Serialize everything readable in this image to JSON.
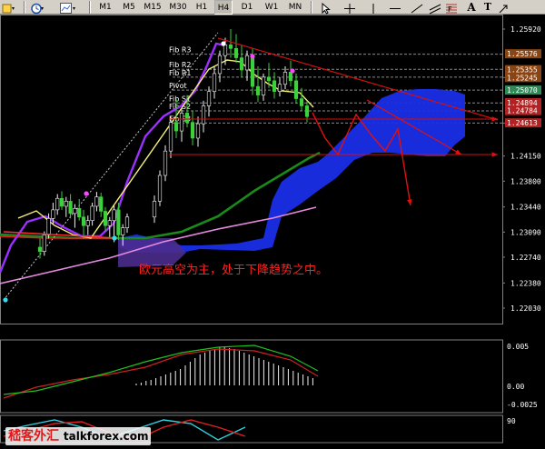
{
  "toolbar": {
    "timeframes": [
      "M1",
      "M5",
      "M15",
      "M30",
      "H1",
      "H4",
      "D1",
      "W1",
      "MN"
    ],
    "active_timeframe": "H4",
    "icons": [
      "dropdown-icon",
      "clock-icon",
      "chart-type-icon",
      "cursor-icon",
      "crosshair-icon",
      "vertical-line-icon",
      "horizontal-line-icon",
      "trendline-icon",
      "channel-icon",
      "fibonacci-icon",
      "text-icon",
      "label-icon",
      "arrow-tool-icon"
    ],
    "text_tool_label": "A",
    "label_tool_label": "T"
  },
  "annotation": "欧元高空为主，处于下降趋势之中。",
  "watermark": {
    "text": "嵇客外汇",
    "site": "talkforex.com"
  },
  "chart_data": {
    "type": "candlestick",
    "symbol_period": "H4",
    "price_axis_labels": [
      "1.25920",
      "1.25245",
      "1.24610",
      "1.24150",
      "1.23800",
      "1.23440",
      "1.23090",
      "1.22740",
      "1.22380",
      "1.22030"
    ],
    "highlighted_prices": [
      {
        "value": "1.25576",
        "color": "#8b4513"
      },
      {
        "value": "1.25355",
        "color": "#8b4513"
      },
      {
        "value": "1.25245",
        "color": "#8b4513"
      },
      {
        "value": "1.25070",
        "color": "#2e8b57"
      },
      {
        "value": "1.24894",
        "color": "#b22222"
      },
      {
        "value": "1.24784",
        "color": "#b22222"
      },
      {
        "value": "1.24613",
        "color": "#b22222"
      }
    ],
    "fib_levels": [
      {
        "label": "Fib R3",
        "price": 1.2557
      },
      {
        "label": "Fib R2",
        "price": 1.2536
      },
      {
        "label": "Fib R1",
        "price": 1.2525
      },
      {
        "label": "Pivot",
        "price": 1.2507
      },
      {
        "label": "Fib S1",
        "price": 1.2489
      },
      {
        "label": "Fib S2",
        "price": 1.2478
      },
      {
        "label": "Fib S3",
        "price": 1.2461
      }
    ],
    "ylim": [
      1.2195,
      1.2602
    ],
    "n_bars": 80,
    "candles": [
      [
        1.2288,
        1.23,
        1.2272,
        1.2282
      ],
      [
        1.2282,
        1.231,
        1.2276,
        1.2305
      ],
      [
        1.2305,
        1.2335,
        1.23,
        1.2328
      ],
      [
        1.2328,
        1.235,
        1.232,
        1.234
      ],
      [
        1.234,
        1.2362,
        1.2333,
        1.2356
      ],
      [
        1.2356,
        1.2366,
        1.234,
        1.2345
      ],
      [
        1.2345,
        1.2358,
        1.233,
        1.2352
      ],
      [
        1.2352,
        1.2362,
        1.2328,
        1.2335
      ],
      [
        1.2335,
        1.2348,
        1.2315,
        1.2342
      ],
      [
        1.2342,
        1.2355,
        1.2325,
        1.233
      ],
      [
        1.233,
        1.234,
        1.23,
        1.2318
      ],
      [
        1.2318,
        1.2332,
        1.2305,
        1.2325
      ],
      [
        1.2325,
        1.235,
        1.2318,
        1.2345
      ],
      [
        1.2345,
        1.2365,
        1.2338,
        1.2358
      ],
      [
        1.2358,
        1.2364,
        1.233,
        1.2338
      ],
      [
        1.2338,
        1.2344,
        1.231,
        1.2318
      ],
      [
        1.2318,
        1.233,
        1.2302,
        1.2325
      ],
      [
        1.2325,
        1.2346,
        1.2295,
        1.234
      ],
      [
        1.234,
        1.235,
        1.2298,
        1.2305
      ],
      [
        1.2305,
        1.232,
        1.229,
        1.2315
      ],
      [
        1.2315,
        1.2335,
        1.2308,
        1.233
      ],
      [
        1.233,
        1.236,
        1.2322,
        1.2352
      ],
      [
        1.2352,
        1.2395,
        1.2345,
        1.2388
      ],
      [
        1.2388,
        1.243,
        1.238,
        1.2422
      ],
      [
        1.2422,
        1.247,
        1.2412,
        1.2462
      ],
      [
        1.2462,
        1.2495,
        1.244,
        1.245
      ],
      [
        1.245,
        1.248,
        1.2435,
        1.2475
      ],
      [
        1.2475,
        1.25,
        1.2455,
        1.2462
      ],
      [
        1.2462,
        1.2478,
        1.243,
        1.244
      ],
      [
        1.244,
        1.247,
        1.2428,
        1.246
      ],
      [
        1.246,
        1.2492,
        1.2448,
        1.2485
      ],
      [
        1.2485,
        1.2512,
        1.247,
        1.2505
      ],
      [
        1.2505,
        1.254,
        1.2495,
        1.253
      ],
      [
        1.253,
        1.2562,
        1.2518,
        1.2555
      ],
      [
        1.2555,
        1.258,
        1.2542,
        1.257
      ],
      [
        1.257,
        1.2592,
        1.2552,
        1.2565
      ],
      [
        1.2565,
        1.2585,
        1.2545,
        1.2552
      ],
      [
        1.2552,
        1.257,
        1.2525,
        1.2535
      ],
      [
        1.2535,
        1.2562,
        1.252,
        1.2555
      ],
      [
        1.2555,
        1.2565,
        1.25,
        1.2512
      ],
      [
        1.2512,
        1.254,
        1.249,
        1.25
      ],
      [
        1.25,
        1.253,
        1.2492,
        1.2525
      ],
      [
        1.2525,
        1.2545,
        1.251,
        1.252
      ],
      [
        1.252,
        1.2532,
        1.2495,
        1.2505
      ],
      [
        1.2505,
        1.2525,
        1.2498,
        1.2515
      ],
      [
        1.2515,
        1.254,
        1.2508,
        1.2532
      ],
      [
        1.2532,
        1.2548,
        1.2512,
        1.252
      ],
      [
        1.252,
        1.253,
        1.2488,
        1.2495
      ],
      [
        1.2495,
        1.251,
        1.2478,
        1.2485
      ],
      [
        1.2485,
        1.2492,
        1.2462,
        1.247
      ]
    ],
    "indicators": {
      "upper_panel": [
        "purple moving average",
        "green moving average",
        "pink moving average",
        "red moving average",
        "yellow-white moving average",
        "blue cloud",
        "dotted trendline"
      ],
      "lower_panel_1": {
        "type": "histogram",
        "axis_labels": [
          "0.005",
          "0.00",
          "-0.0025"
        ]
      },
      "lower_panel_2": {
        "type": "oscillator",
        "axis_labels": [
          "90"
        ]
      }
    }
  }
}
